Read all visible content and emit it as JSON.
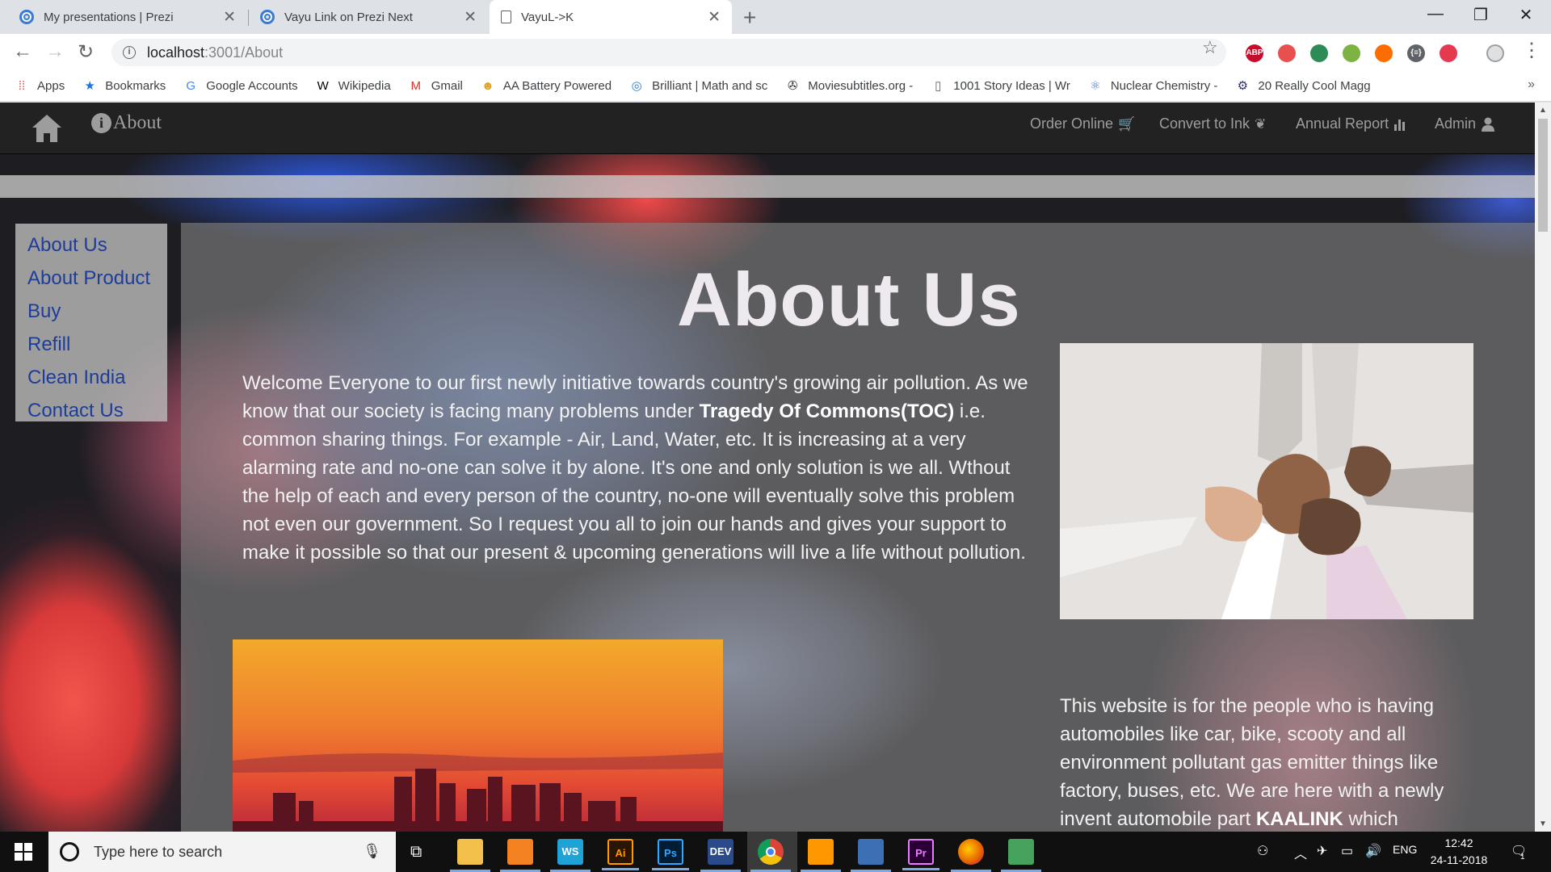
{
  "browser": {
    "tabs": [
      {
        "title": "My presentations | Prezi",
        "favicon": "prezi-icon",
        "active": false
      },
      {
        "title": "Vayu Link on Prezi Next",
        "favicon": "prezi-icon",
        "active": false
      },
      {
        "title": "VayuL->K",
        "favicon": "document-icon",
        "active": true
      }
    ],
    "url_host": "localhost",
    "url_path": ":3001/About",
    "bookmarks": [
      {
        "label": "Apps",
        "icon": "apps-grid-icon"
      },
      {
        "label": "Bookmarks",
        "icon": "star-icon"
      },
      {
        "label": "Google Accounts",
        "icon": "google-icon"
      },
      {
        "label": "Wikipedia",
        "icon": "wikipedia-icon"
      },
      {
        "label": "Gmail",
        "icon": "gmail-icon"
      },
      {
        "label": "AA Battery Powered",
        "icon": "battery-site-icon"
      },
      {
        "label": "Brilliant | Math and sc",
        "icon": "brilliant-icon"
      },
      {
        "label": "Moviesubtitles.org -",
        "icon": "subtitles-icon"
      },
      {
        "label": "1001 Story Ideas | Wr",
        "icon": "page-icon"
      },
      {
        "label": "Nuclear Chemistry -",
        "icon": "chemistry-icon"
      },
      {
        "label": "20 Really Cool Magg",
        "icon": "gear-site-icon"
      }
    ],
    "extensions": [
      {
        "label": "ABP",
        "icon": "adblock-plus-icon",
        "color": "#c70d2c"
      },
      {
        "label": "",
        "icon": "blocker-icon",
        "color": "#e85050"
      },
      {
        "label": "",
        "icon": "globe-extension-icon",
        "color": "#2e8b57"
      },
      {
        "label": "",
        "icon": "check-extension-icon",
        "color": "#7cb342"
      },
      {
        "label": "",
        "icon": "orange-extension-icon",
        "color": "#ff6d00"
      },
      {
        "label": "{≡}",
        "icon": "json-viewer-icon",
        "color": "#5f6368"
      },
      {
        "label": "",
        "icon": "shield-extension-icon",
        "color": "#e53950"
      }
    ]
  },
  "site": {
    "nav_about": "About",
    "nav_right": [
      {
        "label": "Order Online",
        "icon": "cart-icon"
      },
      {
        "label": "Convert to Ink",
        "icon": "leaf-icon"
      },
      {
        "label": "Annual Report",
        "icon": "bar-chart-icon"
      },
      {
        "label": "Admin",
        "icon": "user-icon"
      }
    ],
    "sidebar": [
      "About Us",
      "About Product",
      "Buy",
      "Refill",
      "Clean India",
      "Contact Us"
    ],
    "heading": "About Us",
    "paragraph_1_before": "Welcome Everyone to our first newly initiative towards country's growing air pollution. As we know that our society is facing many problems under ",
    "paragraph_1_bold": "Tragedy Of Commons(TOC)",
    "paragraph_1_after": " i.e. common sharing things. For example - Air, Land, Water, etc. It is increasing at a very alarming rate and no-one can solve it by alone. It's one and only solution is we all. Wthout the help of each and every person of the country, no-one will eventually solve this problem not even our government. So I request you all to join our hands and gives your support to make it possible so that our present & upcoming generations will live a life without pollution.",
    "paragraph_2_before": "This website is for the people who is having automobiles like car, bike, scooty and all environment pollutant gas emitter things like factory, buses, etc. We are here with a newly invent automobile part ",
    "paragraph_2_bold": "KAALINK",
    "paragraph_2_after": " which",
    "colors": {
      "navbar": "#222222",
      "nav_text": "#9d9d9d",
      "sidebar_link": "#1e3d9a"
    }
  },
  "taskbar": {
    "search_placeholder": "Type here to search",
    "time": "12:42",
    "date": "24-11-2018",
    "language": "ENG",
    "notification_count": "1",
    "apps": [
      {
        "icon": "file-explorer-icon",
        "label": ""
      },
      {
        "icon": "vlc-icon",
        "label": ""
      },
      {
        "icon": "webstorm-icon",
        "label": "WS"
      },
      {
        "icon": "illustrator-icon",
        "label": "Ai"
      },
      {
        "icon": "photoshop-icon",
        "label": "Ps"
      },
      {
        "icon": "dev-cpp-icon",
        "label": "DEV"
      },
      {
        "icon": "chrome-icon",
        "label": ""
      },
      {
        "icon": "sublime-text-icon",
        "label": ""
      },
      {
        "icon": "network-globe-icon",
        "label": ""
      },
      {
        "icon": "premiere-icon",
        "label": "Pr"
      },
      {
        "icon": "firefox-icon",
        "label": ""
      },
      {
        "icon": "git-icon",
        "label": ""
      }
    ]
  }
}
